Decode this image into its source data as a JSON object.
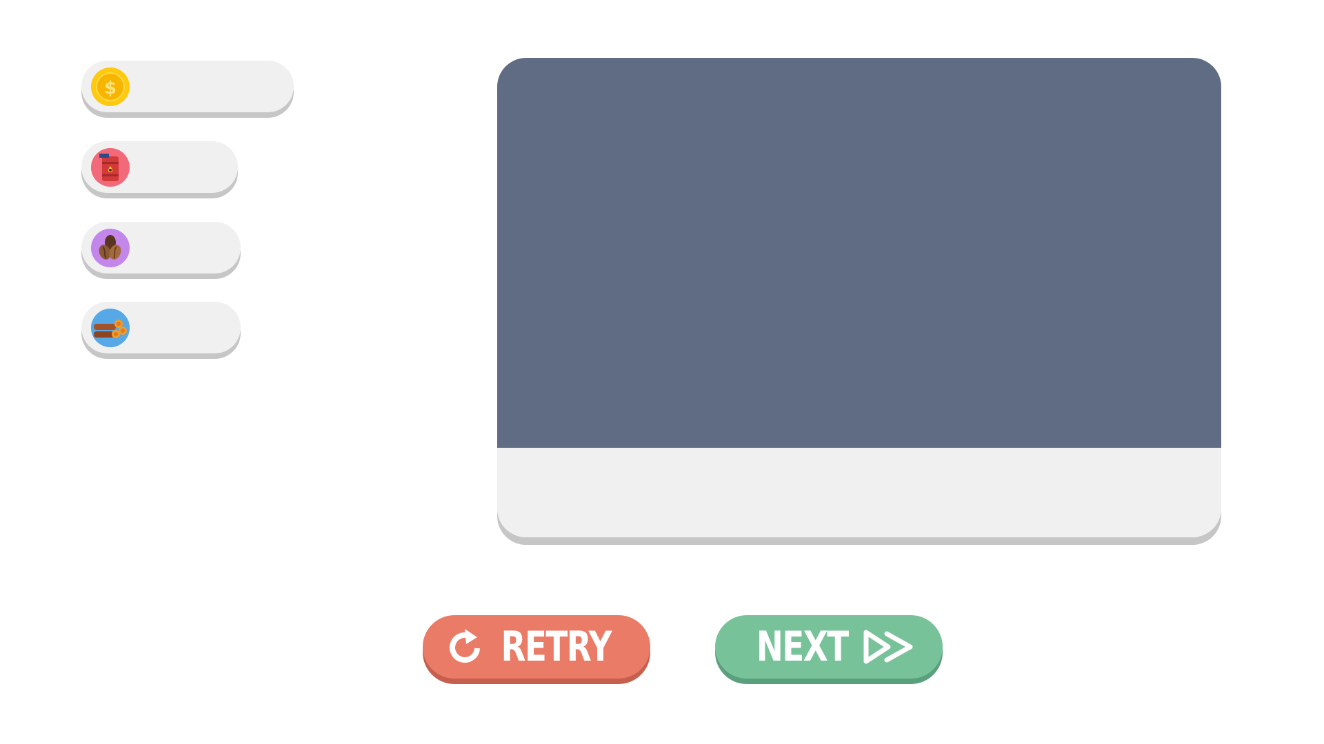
{
  "resources": [
    {
      "name": "coins",
      "icon": "coin-icon",
      "icon_bg": "#ffc90e",
      "value": ""
    },
    {
      "name": "oil",
      "icon": "oil-barrel-icon",
      "icon_bg": "#f2697a",
      "value": ""
    },
    {
      "name": "coffee",
      "icon": "coffee-beans-icon",
      "icon_bg": "#c387ec",
      "value": ""
    },
    {
      "name": "wood",
      "icon": "wood-logs-icon",
      "icon_bg": "#56a8e6",
      "value": ""
    }
  ],
  "buttons": {
    "retry_label": "RETRY",
    "next_label": "NEXT"
  },
  "colors": {
    "panel_screen": "#606c84",
    "panel_base": "#f0f0f0",
    "retry": "#e97b67",
    "next": "#78c29a"
  }
}
